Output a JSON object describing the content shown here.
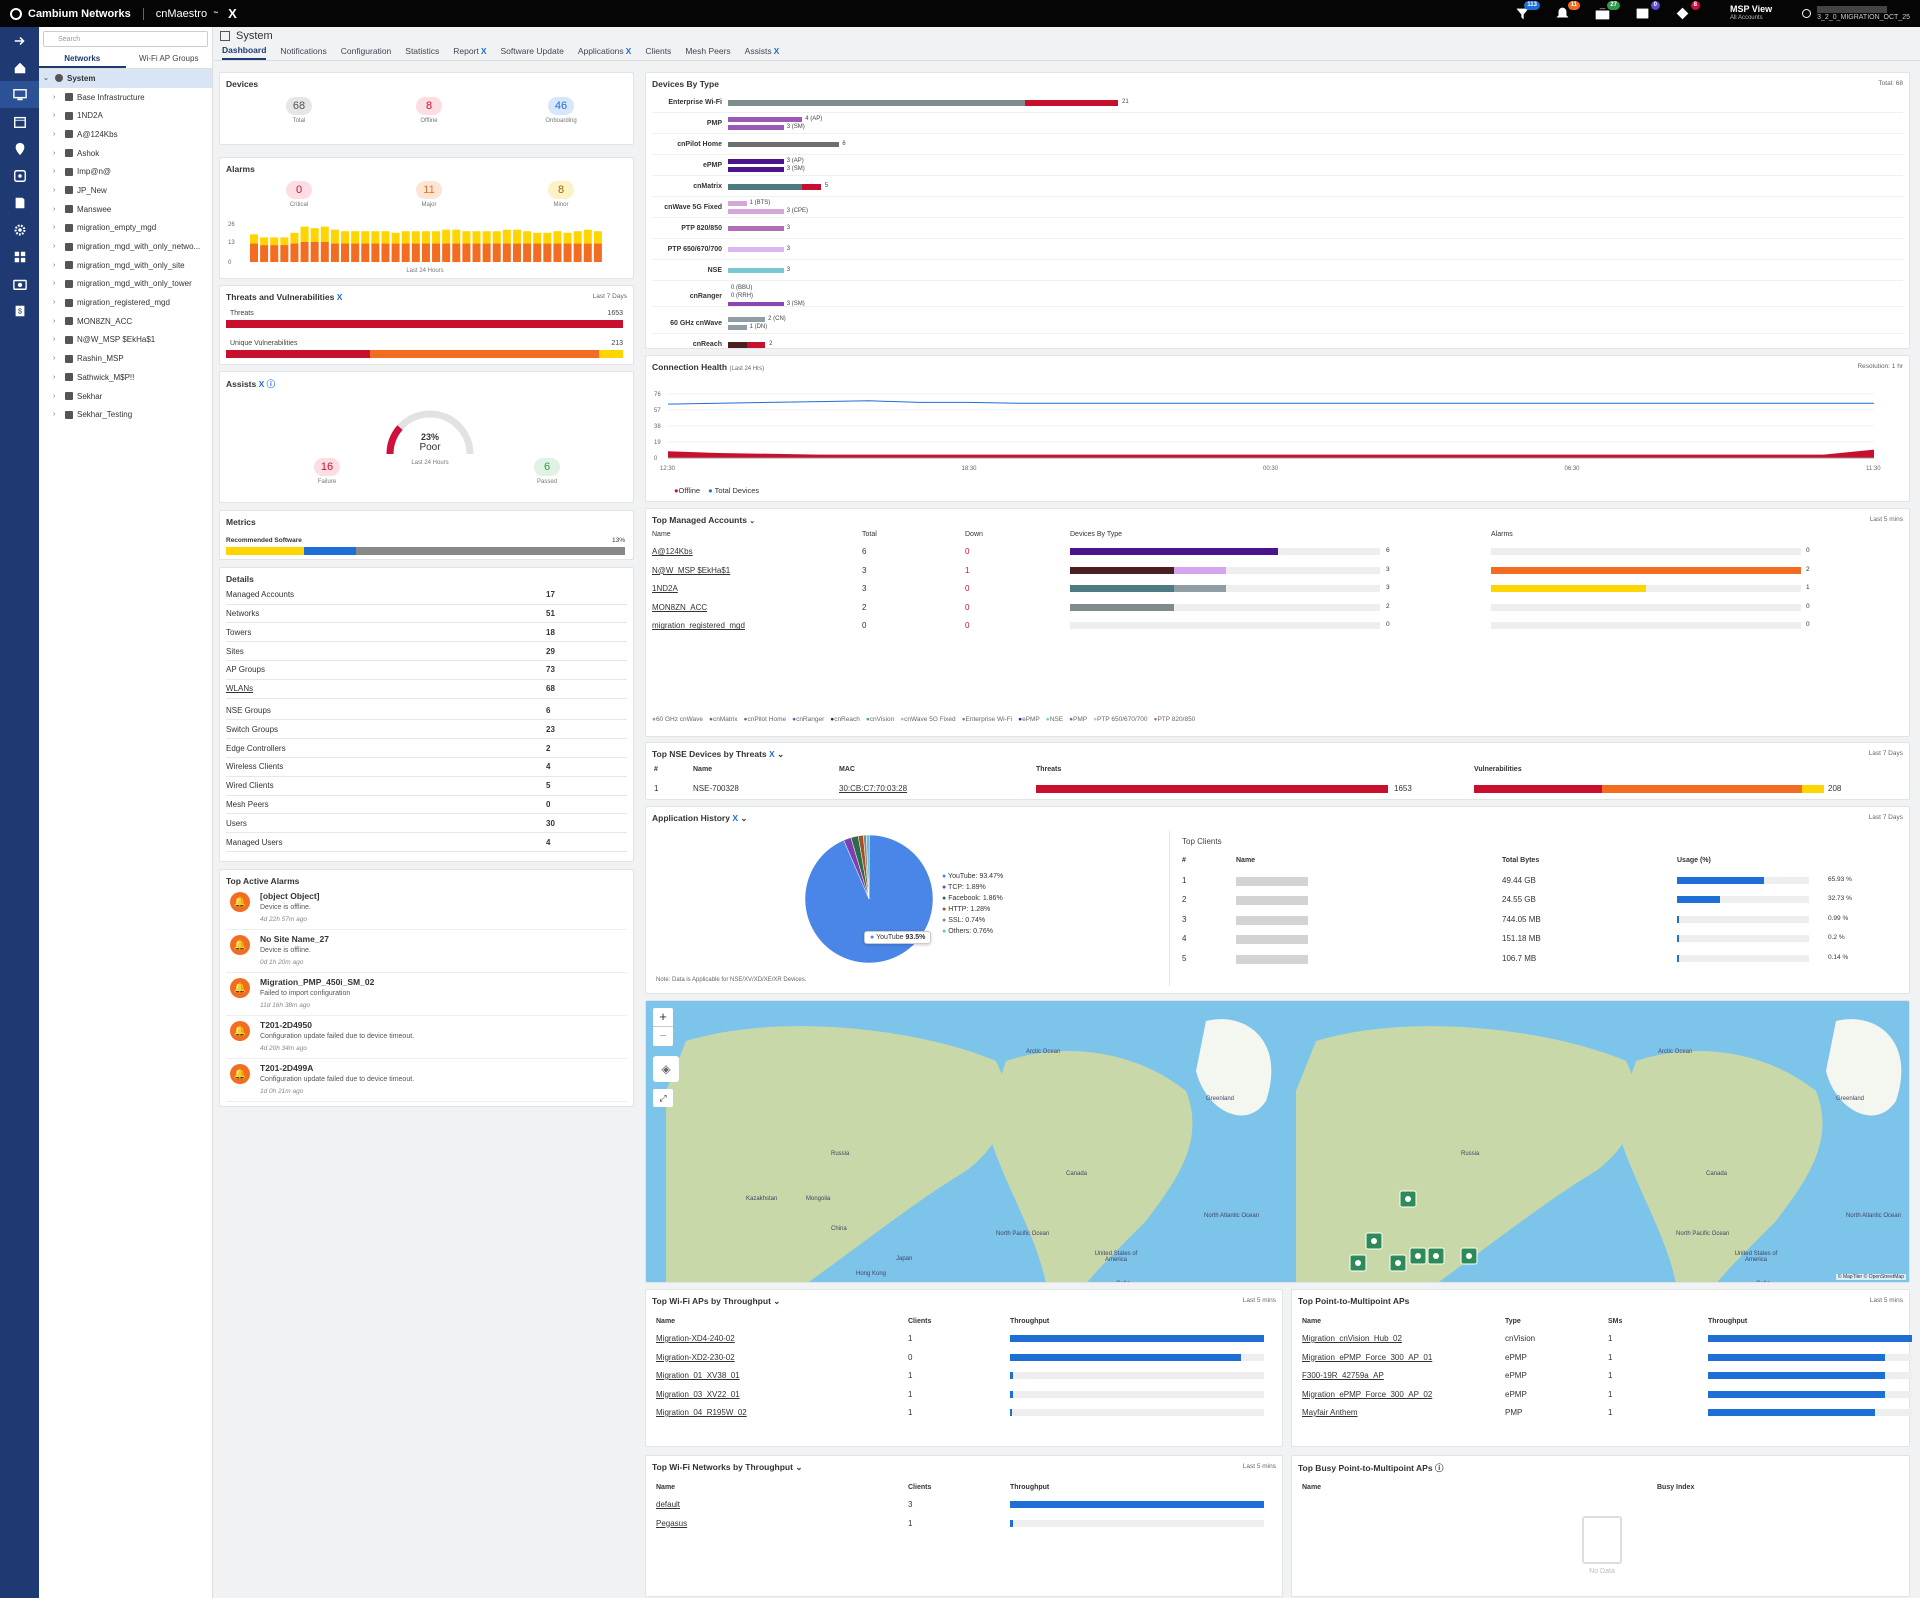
{
  "topbar": {
    "brand": "Cambium Networks",
    "product": "cnMaestro",
    "product_tm": "™",
    "product_x": "X",
    "msp_title": "MSP View",
    "msp_sub": "All Accounts",
    "user_suffix": "3_2_0_MIGRATION_OCT_25",
    "badges": [
      {
        "name": "devices-badge",
        "value": "113",
        "color": "#1d6fd6"
      },
      {
        "name": "alarms-badge",
        "value": "11",
        "color": "#f26c22"
      },
      {
        "name": "updates-badge",
        "value": "27",
        "color": "#2f9a4a"
      },
      {
        "name": "tasks-badge",
        "value": "0",
        "color": "#5a4bd6"
      },
      {
        "name": "threats-badge",
        "value": "8",
        "color": "#d0103a"
      }
    ]
  },
  "sidebar": {
    "search_placeholder": "Search",
    "tabs": [
      "Networks",
      "Wi-Fi AP Groups"
    ],
    "items": [
      "System",
      "Base Infrastructure",
      "1ND2A",
      "A@124Kbs",
      "Ashok",
      "Imp@n@",
      "JP_New",
      "Manswee",
      "migration_empty_mgd",
      "migration_mgd_with_only_netwo...",
      "migration_mgd_with_only_site",
      "migration_mgd_with_only_tower",
      "migration_registered_mgd",
      "MON8ZN_ACC",
      "N@W_MSP $EkHa$1",
      "Rashin_MSP",
      "Sathwick_M$P!!",
      "Sekhar",
      "Sekhar_Testing"
    ]
  },
  "page": {
    "title": "System",
    "tabs": [
      "Dashboard",
      "Notifications",
      "Configuration",
      "Statistics",
      "Report",
      "Software Update",
      "Applications",
      "Clients",
      "Mesh Peers",
      "Assists"
    ]
  },
  "devices": {
    "title": "Devices",
    "items": [
      {
        "value": "68",
        "label": "Total",
        "bg": "#e6e6e6",
        "fg": "#555"
      },
      {
        "value": "8",
        "label": "Offline",
        "bg": "#fbdde3",
        "fg": "#c8102e"
      },
      {
        "value": "46",
        "label": "Onboarding",
        "bg": "#d8e6fa",
        "fg": "#1d6fd6"
      }
    ]
  },
  "alarms": {
    "title": "Alarms",
    "items": [
      {
        "value": "0",
        "label": "Critical",
        "bg": "#fbdde3",
        "fg": "#c8102e"
      },
      {
        "value": "11",
        "label": "Major",
        "bg": "#fde5d6",
        "fg": "#f26c22"
      },
      {
        "value": "8",
        "label": "Minor",
        "bg": "#fdf2c6",
        "fg": "#8a6d00"
      }
    ],
    "yticks": [
      "26",
      "13",
      "0"
    ],
    "footer": "Last 24 Hours",
    "chart_data": {
      "type": "bar",
      "series": [
        {
          "name": "Major",
          "color": "#f26c22"
        },
        {
          "name": "Minor",
          "color": "#ffd500"
        }
      ],
      "major": [
        12,
        11,
        11,
        11,
        12,
        13,
        13,
        13,
        12,
        12,
        12,
        12,
        12,
        12,
        12,
        12,
        12,
        12,
        12,
        12,
        12,
        12,
        12,
        12,
        12,
        12,
        12,
        12,
        12,
        12,
        12,
        12,
        12,
        12,
        12
      ],
      "minor": [
        6,
        5,
        5,
        5,
        7,
        10,
        9,
        10,
        9,
        8,
        8,
        8,
        8,
        8,
        7,
        8,
        8,
        8,
        8,
        9,
        9,
        8,
        8,
        8,
        8,
        9,
        9,
        8,
        7,
        7,
        8,
        7,
        8,
        9,
        8
      ],
      "ylim": [
        0,
        26
      ]
    }
  },
  "threats": {
    "title": "Threats and Vulnerabilities",
    "period": "Last 7 Days",
    "threats_label": "Threats",
    "threats_value": "1653",
    "vuln_label": "Unique Vulnerabilities",
    "vuln_value": "213"
  },
  "assists": {
    "title": "Assists",
    "gauge_value": "23%",
    "gauge_label": "Poor",
    "gauge_pct": 23,
    "footer": "Last 24 Hours",
    "items": [
      {
        "value": "16",
        "label": "Failure",
        "bg": "#fbdde3",
        "fg": "#c8102e"
      },
      {
        "value": "6",
        "label": "Passed",
        "bg": "#dff2e4",
        "fg": "#2f9a4a"
      }
    ]
  },
  "metrics": {
    "title": "Metrics",
    "label": "Recommended Software",
    "value": "13%"
  },
  "details": {
    "title": "Details",
    "rows": [
      [
        "Managed Accounts",
        "17"
      ],
      [
        "Networks",
        "51"
      ],
      [
        "Towers",
        "18"
      ],
      [
        "Sites",
        "29"
      ],
      [
        "AP Groups",
        "73"
      ],
      [
        "WLANs",
        "68"
      ],
      [
        "NSE Groups",
        "6"
      ],
      [
        "Switch Groups",
        "23"
      ],
      [
        "Edge Controllers",
        "2"
      ],
      [
        "Wireless Clients",
        "4"
      ],
      [
        "Wired Clients",
        "5"
      ],
      [
        "Mesh Peers",
        "0"
      ],
      [
        "Users",
        "30"
      ],
      [
        "Managed Users",
        "4"
      ]
    ]
  },
  "top_alarms": {
    "title": "Top Active Alarms",
    "items": [
      {
        "title": "[object Object]",
        "desc": "Device is offline.",
        "time": "4d 22h 57m ago"
      },
      {
        "title": "No Site Name_27",
        "desc": "Device is offline.",
        "time": "0d 1h 20m ago"
      },
      {
        "title": "Migration_PMP_450i_SM_02",
        "desc": "Failed to import configuration",
        "time": "11d 16h 38m ago"
      },
      {
        "title": "T201-2D4950",
        "desc": "Configuration update failed due to device timeout.",
        "time": "4d 20h 34m ago"
      },
      {
        "title": "T201-2D499A",
        "desc": "Configuration update failed due to device timeout.",
        "time": "1d 0h 21m ago"
      }
    ]
  },
  "devices_by_type": {
    "title": "Devices By Type",
    "total": "Total: 68",
    "chart_data": {
      "type": "bar",
      "rows": [
        {
          "name": "Enterprise Wi-Fi",
          "bars": [
            {
              "value": 16,
              "color": "#7f8c8d",
              "label": ""
            },
            {
              "value": 5,
              "color": "#c8102e",
              "label": "21"
            }
          ]
        },
        {
          "name": "PMP",
          "bars": [
            {
              "value": 4,
              "color": "#9b59b6",
              "label": "4 (AP)"
            },
            {
              "value": 3,
              "color": "#9b59b6",
              "label": "3 (SM)"
            }
          ]
        },
        {
          "name": "cnPilot Home",
          "bars": [
            {
              "value": 6,
              "color": "#6d6e70",
              "label": "6"
            }
          ]
        },
        {
          "name": "ePMP",
          "bars": [
            {
              "value": 3,
              "color": "#4a148c",
              "label": "3 (AP)"
            },
            {
              "value": 3,
              "color": "#4a148c",
              "label": "3 (SM)"
            }
          ]
        },
        {
          "name": "cnMatrix",
          "bars": [
            {
              "value": 4,
              "color": "#4d7a80",
              "label": ""
            },
            {
              "value": 1,
              "color": "#c8102e",
              "label": "5"
            }
          ]
        },
        {
          "name": "cnWave 5G Fixed",
          "bars": [
            {
              "value": 1,
              "color": "#d5a6d6",
              "label": "1 (BTS)"
            },
            {
              "value": 3,
              "color": "#d5a6d6",
              "label": "3 (CPE)"
            }
          ]
        },
        {
          "name": "PTP 820/850",
          "bars": [
            {
              "value": 3,
              "color": "#b36fb4",
              "label": "3"
            }
          ]
        },
        {
          "name": "PTP 650/670/700",
          "bars": [
            {
              "value": 3,
              "color": "#dcb6ef",
              "label": "3"
            }
          ]
        },
        {
          "name": "NSE",
          "bars": [
            {
              "value": 3,
              "color": "#7ac7d4",
              "label": "3"
            }
          ]
        },
        {
          "name": "cnRanger",
          "bars": [
            {
              "value": 0,
              "color": "#8e44ad",
              "label": "0 (BBU)"
            },
            {
              "value": 0,
              "color": "#8e44ad",
              "label": "0 (RRH)"
            },
            {
              "value": 3,
              "color": "#8e44ad",
              "label": "3 (SM)"
            }
          ]
        },
        {
          "name": "60 GHz cnWave",
          "bars": [
            {
              "value": 2,
              "color": "#8e9ea4",
              "label": "2 (CN)"
            },
            {
              "value": 1,
              "color": "#8e9ea4",
              "label": "1 (DN)"
            }
          ]
        },
        {
          "name": "cnReach",
          "bars": [
            {
              "value": 1,
              "color": "#4a1f1f",
              "label": ""
            },
            {
              "value": 1,
              "color": "#c8102e",
              "label": "2"
            }
          ]
        },
        {
          "name": "cnVision",
          "bars": [
            {
              "value": 1,
              "color": "#4ba3b5",
              "label": "1 (Hub)"
            },
            {
              "value": 1,
              "color": "#4ba3b5",
              "label": "1 (Client)"
            }
          ]
        }
      ],
      "xmax": 21
    }
  },
  "connection_health": {
    "title": "Connection Health",
    "subtitle": "(Last 24 Hrs)",
    "resolution": "Resolution: 1 hr",
    "chart_data": {
      "type": "area",
      "yticks": [
        "76",
        "57",
        "38",
        "19",
        "0"
      ],
      "xticks": [
        "12:30",
        "18:30",
        "00:30",
        "06:30",
        "11:30"
      ],
      "ylim": [
        0,
        76
      ],
      "series": [
        {
          "name": "Offline",
          "color": "#c8102e",
          "values": [
            8,
            6,
            5,
            4,
            4,
            4,
            4,
            4,
            4,
            4,
            4,
            4,
            4,
            4,
            4,
            4,
            4,
            4,
            4,
            4,
            4,
            4,
            4,
            4,
            10
          ]
        },
        {
          "name": "Total Devices",
          "color": "#1d6fd6",
          "values": [
            64,
            65,
            66,
            67,
            68,
            66,
            66,
            65,
            65,
            65,
            65,
            65,
            65,
            65,
            65,
            65,
            65,
            65,
            65,
            65,
            65,
            65,
            65,
            65,
            65
          ]
        }
      ]
    }
  },
  "top_managed": {
    "title": "Top Managed Accounts",
    "period": "Last 5 mins",
    "headers": [
      "Name",
      "Total",
      "Down",
      "Devices By Type",
      "Alarms"
    ],
    "rows": [
      {
        "name": "A@124Kbs",
        "total": "6",
        "down": "0",
        "dev": [
          {
            "w": 100,
            "c": "#4a148c"
          }
        ],
        "dev_val": "6",
        "alarm": [],
        "alarm_val": "0"
      },
      {
        "name": "N@W_MSP $EkHa$1",
        "total": "3",
        "down": "1",
        "dev": [
          {
            "w": 50,
            "c": "#4a1f1f"
          },
          {
            "w": 25,
            "c": "#d5a6ef"
          }
        ],
        "dev_val": "3",
        "alarm": [
          {
            "w": 100,
            "c": "#f26c22"
          }
        ],
        "alarm_val": "2"
      },
      {
        "name": "1ND2A",
        "total": "3",
        "down": "0",
        "dev": [
          {
            "w": 50,
            "c": "#4d7a80"
          },
          {
            "w": 25,
            "c": "#8e9ea4"
          }
        ],
        "dev_val": "3",
        "alarm": [
          {
            "w": 50,
            "c": "#ffd500"
          }
        ],
        "alarm_val": "1"
      },
      {
        "name": "MON8ZN_ACC",
        "total": "2",
        "down": "0",
        "dev": [
          {
            "w": 50,
            "c": "#7f8c8d"
          }
        ],
        "dev_val": "2",
        "alarm": [],
        "alarm_val": "0"
      },
      {
        "name": "migration_registered_mgd",
        "total": "0",
        "down": "0",
        "dev": [],
        "dev_val": "0",
        "alarm": [],
        "alarm_val": "0"
      }
    ],
    "legend": [
      "60 GHz cnWave",
      "cnMatrix",
      "cnPilot Home",
      "cnRanger",
      "cnReach",
      "cnVision",
      "cnWave 5G Fixed",
      "Enterprise Wi-Fi",
      "ePMP",
      "NSE",
      "PMP",
      "PTP 650/670/700",
      "PTP 820/850"
    ],
    "legend_colors": [
      "#8e9ea4",
      "#4d7a80",
      "#6d6e70",
      "#8e44ad",
      "#4a1f1f",
      "#4ba3b5",
      "#d5a6d6",
      "#7f8c8d",
      "#4a148c",
      "#7ac7d4",
      "#9b59b6",
      "#dcb6ef",
      "#b36fb4"
    ]
  },
  "top_nse": {
    "title": "Top NSE Devices by Threats",
    "period": "Last 7 Days",
    "headers": [
      "#",
      "Name",
      "MAC",
      "Threats",
      "Vulnerabilities"
    ],
    "row": {
      "idx": "1",
      "name": "NSE-700328",
      "mac": "30:CB:C7:70:03:28",
      "threats": "1653",
      "vuln": "208"
    }
  },
  "app_history": {
    "title": "Application History",
    "period": "Last 7 Days",
    "note": "Note: Data is Applicable for NSE/XV/XD/XE/XR Devices.",
    "tooltip_label": "YouTube",
    "tooltip_value": "93.5%",
    "chart_data": {
      "type": "pie",
      "slices": [
        {
          "name": "YouTube: 93.47%",
          "value": 93.47,
          "color": "#4a86e8"
        },
        {
          "name": "TCP: 1.89%",
          "value": 1.89,
          "color": "#7b3fb0"
        },
        {
          "name": "Facebook: 1.86%",
          "value": 1.86,
          "color": "#2e6b47"
        },
        {
          "name": "HTTP: 1.28%",
          "value": 1.28,
          "color": "#a0522d"
        },
        {
          "name": "SSL: 0.74%",
          "value": 0.74,
          "color": "#888888"
        },
        {
          "name": "Others: 0.76%",
          "value": 0.76,
          "color": "#66c2d9"
        }
      ]
    },
    "clients_title": "Top Clients",
    "clients_headers": [
      "#",
      "Name",
      "Total Bytes",
      "Usage (%)"
    ],
    "clients": [
      {
        "idx": "1",
        "bytes": "49.44 GB",
        "pct": 65.93,
        "pct_label": "65.93 %"
      },
      {
        "idx": "2",
        "bytes": "24.55 GB",
        "pct": 32.73,
        "pct_label": "32.73 %"
      },
      {
        "idx": "3",
        "bytes": "744.05 MB",
        "pct": 0.99,
        "pct_label": "0.99 %"
      },
      {
        "idx": "4",
        "bytes": "151.18 MB",
        "pct": 0.2,
        "pct_label": "0.2 %"
      },
      {
        "idx": "5",
        "bytes": "106.7 MB",
        "pct": 0.14,
        "pct_label": "0.14 %"
      }
    ]
  },
  "map": {
    "labels": [
      "Arctic Ocean",
      "Greenland",
      "North Pacific Ocean",
      "North Atlantic Ocean",
      "Russia",
      "Canada",
      "China",
      "United States of America",
      "Mongolia",
      "Kazakhstan",
      "Cuba",
      "Hong Kong",
      "Japan",
      "Arctic Ocean",
      "Greenland",
      "North Pacific Ocean",
      "North Atlantic Ocean",
      "Russia",
      "Canada",
      "United States of America",
      "Cuba"
    ],
    "attribution": "© MapTiler © OpenStreetMap"
  },
  "top_wifi_aps": {
    "title": "Top Wi-Fi APs by Throughput",
    "period": "Last 5 mins",
    "headers": [
      "Name",
      "Clients",
      "Throughput"
    ],
    "rows": [
      {
        "name": "Migration-XD4-240-02",
        "clients": "1",
        "pct": 100
      },
      {
        "name": "Migration-XD2-230-02",
        "clients": "0",
        "pct": 91
      },
      {
        "name": "Migration_01_XV38_01",
        "clients": "1",
        "pct": 1
      },
      {
        "name": "Migration_03_XV22_01",
        "clients": "1",
        "pct": 1
      },
      {
        "name": "Migration_04_R195W_02",
        "clients": "1",
        "pct": 0
      }
    ]
  },
  "top_ptmp": {
    "title": "Top Point-to-Multipoint APs",
    "period": "Last 5 mins",
    "headers": [
      "Name",
      "Type",
      "SMs",
      "Throughput"
    ],
    "rows": [
      {
        "name": "Migration_cnVision_Hub_02",
        "type": "cnVision",
        "sms": "1",
        "pct": 100
      },
      {
        "name": "Migration_ePMP_Force_300_AP_01",
        "type": "ePMP",
        "sms": "1",
        "pct": 87
      },
      {
        "name": "F300-19R_42759a_AP",
        "type": "ePMP",
        "sms": "1",
        "pct": 87
      },
      {
        "name": "Migration_ePMP_Force_300_AP_02",
        "type": "ePMP",
        "sms": "1",
        "pct": 87
      },
      {
        "name": "Mayfair Anthem",
        "type": "PMP",
        "sms": "1",
        "pct": 82
      }
    ]
  },
  "top_wifi_networks": {
    "title": "Top Wi-Fi Networks by Throughput",
    "period": "Last 5 mins",
    "headers": [
      "Name",
      "Clients",
      "Throughput"
    ],
    "rows": [
      {
        "name": "default",
        "clients": "3",
        "pct": 100
      },
      {
        "name": "Pegasus",
        "clients": "1",
        "pct": 1
      }
    ]
  },
  "top_busy_ptmp": {
    "title": "Top Busy Point-to-Multipoint APs",
    "headers": [
      "Name",
      "Busy Index"
    ],
    "empty": "No Data"
  }
}
